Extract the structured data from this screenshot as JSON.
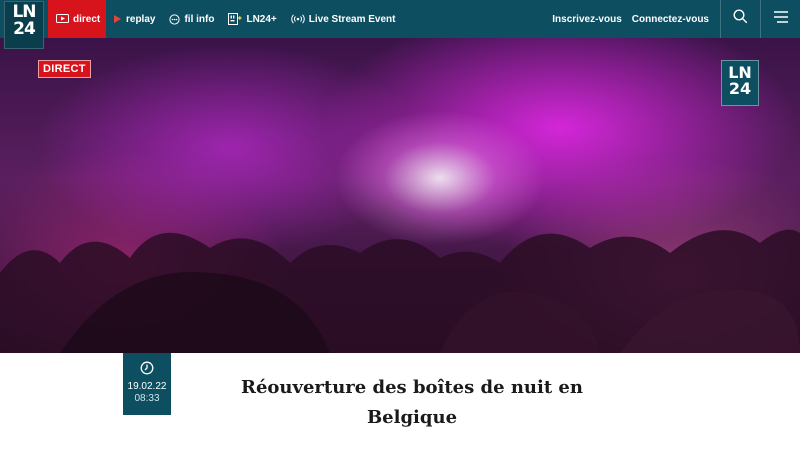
{
  "nav": {
    "logo_line1": "LN",
    "logo_line2": "24",
    "direct_label": "direct",
    "replay_label": "replay",
    "filinfo_label": "fil info",
    "ln24plus_label": "LN24+",
    "livestream_label": "Live Stream Event",
    "signup_label": "Inscrivez-vous",
    "login_label": "Connectez-vous",
    "icons": {
      "direct": "tv-play-icon",
      "replay": "play-icon",
      "filinfo": "fil-info-icon",
      "ln24plus": "ln24plus-icon",
      "livestream": "broadcast-icon",
      "search": "search-icon",
      "menu": "hamburger-menu-icon"
    }
  },
  "hero": {
    "badge": "DIRECT",
    "logo_line1": "LN",
    "logo_line2": "24"
  },
  "article": {
    "date": "19.02.22",
    "time": "08:33",
    "title": "Réouverture des boîtes de nuit en Belgique",
    "clock_icon": "clock-icon"
  },
  "colors": {
    "brand": "#0d4f61",
    "live_red": "#d7131b"
  }
}
